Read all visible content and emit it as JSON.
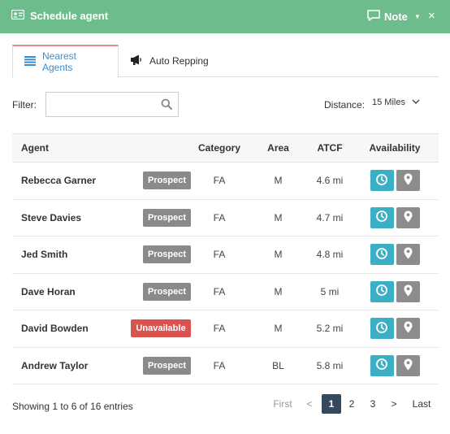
{
  "header": {
    "title": "Schedule agent",
    "note_label": "Note",
    "close_label": "×",
    "bg_color": "#6dbd8c"
  },
  "tabs": [
    {
      "label": "Nearest Agents",
      "icon": "list-icon",
      "active": true
    },
    {
      "label": "Auto Repping",
      "icon": "megaphone-icon",
      "active": false
    }
  ],
  "filter": {
    "label": "Filter:",
    "value": "",
    "placeholder": ""
  },
  "distance": {
    "label": "Distance:",
    "selected": "15 Miles"
  },
  "table": {
    "columns": [
      "Agent",
      "Category",
      "Area",
      "ATCF",
      "Availability"
    ],
    "rows": [
      {
        "agent": "Rebecca Garner",
        "status": "Prospect",
        "category": "FA",
        "area": "M",
        "atcf": "4.6 mi"
      },
      {
        "agent": "Steve Davies",
        "status": "Prospect",
        "category": "FA",
        "area": "M",
        "atcf": "4.7 mi"
      },
      {
        "agent": "Jed Smith",
        "status": "Prospect",
        "category": "FA",
        "area": "M",
        "atcf": "4.8 mi"
      },
      {
        "agent": "Dave Horan",
        "status": "Prospect",
        "category": "FA",
        "area": "M",
        "atcf": "5 mi"
      },
      {
        "agent": "David Bowden",
        "status": "Unavailable",
        "category": "FA",
        "area": "M",
        "atcf": "5.2 mi"
      },
      {
        "agent": "Andrew Taylor",
        "status": "Prospect",
        "category": "FA",
        "area": "BL",
        "atcf": "5.8 mi"
      }
    ]
  },
  "footer": {
    "showing": "Showing 1 to 6 of 16 entries",
    "pager": {
      "first": "First",
      "prev": "<",
      "pages": [
        "1",
        "2",
        "3"
      ],
      "current": "1",
      "next": ">",
      "last": "Last"
    }
  },
  "colors": {
    "accent": "#3a8ed0",
    "clock_button": "#3bb0c4",
    "pin_button": "#8c8c8c",
    "prospect": "#8a8a8a",
    "unavailable": "#d9534f",
    "active_page": "#34495e"
  }
}
